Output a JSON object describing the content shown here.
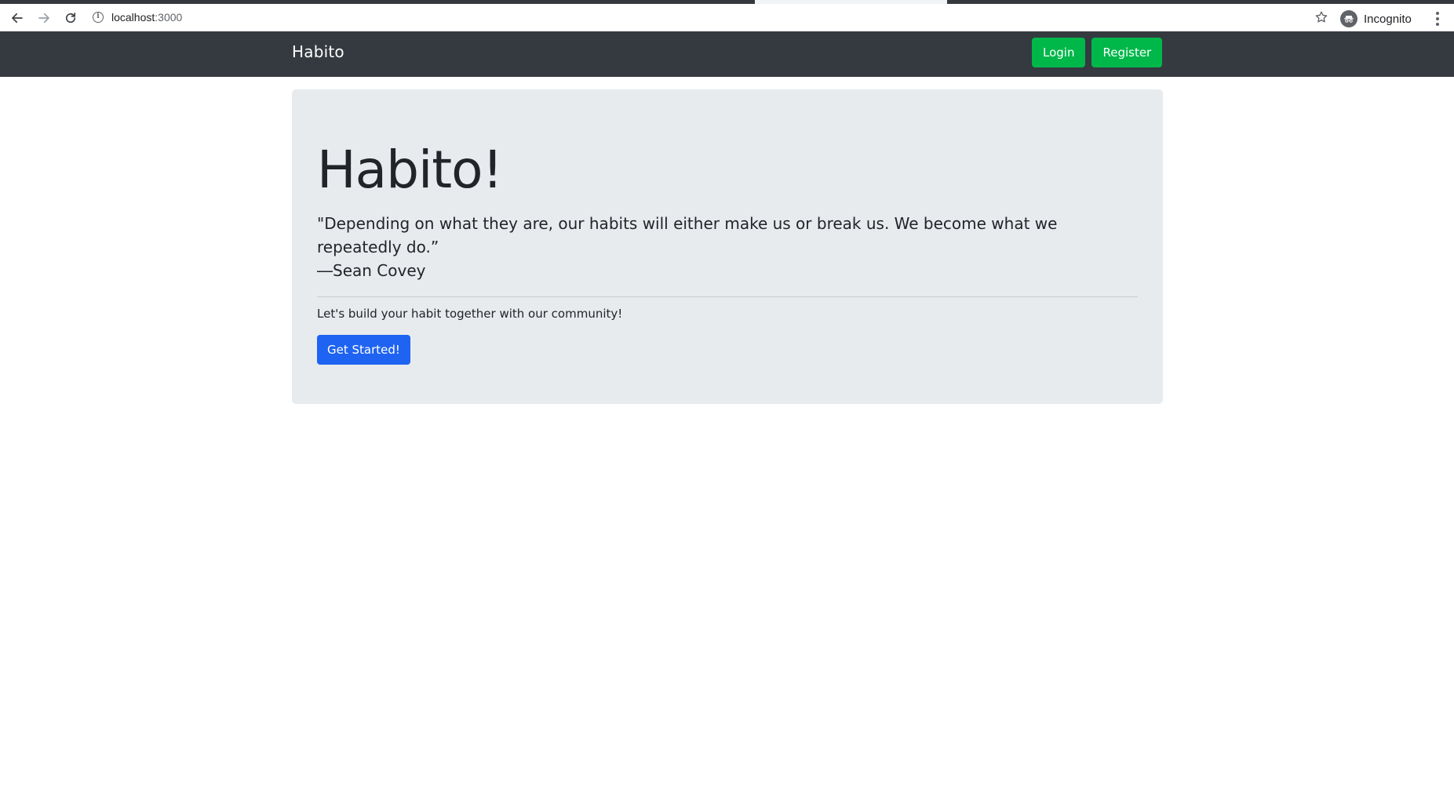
{
  "browser": {
    "url_host": "localhost",
    "url_port": ":3000",
    "profile_label": "Incognito",
    "icons": {
      "back": "back-arrow-icon",
      "forward": "forward-arrow-icon",
      "reload": "reload-icon",
      "info": "info-icon",
      "star": "star-icon",
      "incognito": "incognito-icon",
      "menu": "kebab-menu-icon"
    }
  },
  "navbar": {
    "brand": "Habito",
    "login_label": "Login",
    "register_label": "Register",
    "background_color": "#343a40",
    "button_color": "#00b74a"
  },
  "hero": {
    "title": "Habito!",
    "quote_line1": "\"Depending on what they are, our habits will either make us or break us. We become what we repeatedly do.”",
    "quote_line2": "―Sean Covey",
    "lead": "Let's build your habit together with our community!",
    "cta_label": "Get Started!",
    "cta_color": "#1e63f2",
    "background_color": "#e7ebee"
  }
}
